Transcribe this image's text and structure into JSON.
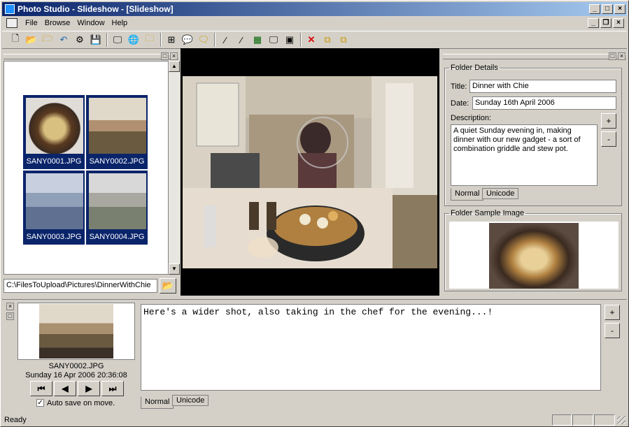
{
  "window": {
    "title": "Photo Studio - Slideshow - [Slideshow]"
  },
  "menu": [
    "File",
    "Browse",
    "Window",
    "Help"
  ],
  "toolbar_icons": [
    "new-icon",
    "open-icon",
    "open-folder-icon",
    "undo-icon",
    "settings-icon",
    "save-icon",
    "present-icon",
    "web-icon",
    "zip-icon",
    "grid-icon",
    "comment-icon",
    "folder-comment-icon",
    "wand-icon",
    "xml-icon",
    "table-icon",
    "slideshow-icon",
    "screen-icon",
    "delete-icon",
    "copy-icon",
    "move-icon"
  ],
  "thumbnails": [
    {
      "label": "SANY0001.JPG"
    },
    {
      "label": "SANY0002.JPG"
    },
    {
      "label": "SANY0003.JPG"
    },
    {
      "label": "SANY0004.JPG"
    }
  ],
  "path": "C:\\FilesToUpload\\Pictures\\DinnerWithChie",
  "folder_details": {
    "legend": "Folder Details",
    "title_label": "Title:",
    "title_value": "Dinner with Chie",
    "date_label": "Date:",
    "date_value": "Sunday 16th April 2006",
    "description_label": "Description:",
    "description_value": "A quiet Sunday evening in, making dinner with our new gadget - a sort of combination griddle and stew pot.",
    "tab_normal": "Normal",
    "tab_unicode": "Unicode",
    "plus": "+",
    "minus": "-"
  },
  "folder_sample": {
    "legend": "Folder Sample Image"
  },
  "current": {
    "filename": "SANY0002.JPG",
    "datetime": "Sunday 16 Apr 2006 20:36:08",
    "autosave_label": "Auto save on move.",
    "autosave_checked": true
  },
  "caption": {
    "text": "Here's a wider shot, also taking in the chef for the evening...!",
    "tab_normal": "Normal",
    "tab_unicode": "Unicode",
    "plus": "+",
    "minus": "-"
  },
  "status": {
    "text": "Ready"
  },
  "nav": {
    "first": "⏮",
    "prev": "◀",
    "next": "▶",
    "last": "⏭"
  },
  "colors": {
    "selection": "#0a246a",
    "title_start": "#0a246a",
    "title_end": "#a6caf0"
  }
}
